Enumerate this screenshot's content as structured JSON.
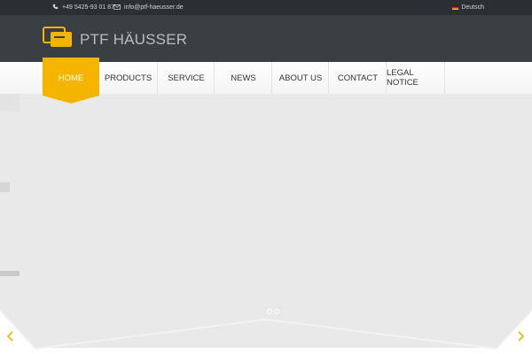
{
  "topbar": {
    "phone": "+49 5425-93 01 87",
    "email": "info@ptf-haeusser.de",
    "language": "Deutsch"
  },
  "header": {
    "logo_text": "PTF HÄUSSER"
  },
  "nav": {
    "items": [
      {
        "label": "HOME",
        "active": true
      },
      {
        "label": "PRODUCTS"
      },
      {
        "label": "SERVICE"
      },
      {
        "label": "NEWS"
      },
      {
        "label": "ABOUT US"
      },
      {
        "label": "CONTACT"
      },
      {
        "label": "LEGAL NOTICE"
      }
    ]
  },
  "slider": {
    "dots": 2,
    "prev_icon": "chevron-left-icon",
    "next_icon": "chevron-right-icon"
  },
  "colors": {
    "accent": "#f5b400",
    "topbar_bg": "#2b2f33",
    "header_bg": "#3a3f44",
    "slider_bg": "#e9e9e9"
  }
}
